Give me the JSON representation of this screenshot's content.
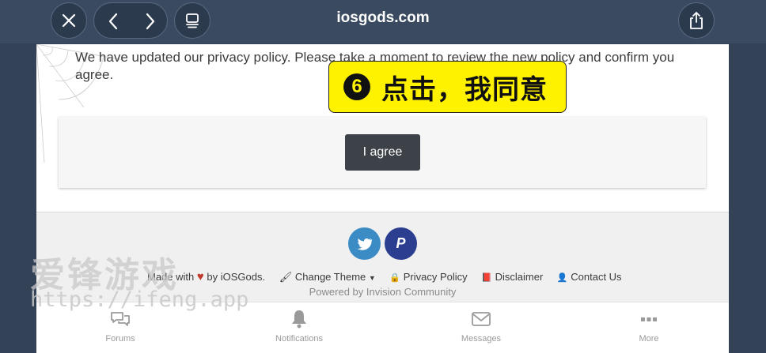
{
  "toolbar": {
    "url": "iosgods.com"
  },
  "policy": {
    "text": "We have updated our privacy policy. Please take a moment to review the new policy and confirm you agree.",
    "agree_label": "I agree"
  },
  "callout": {
    "number": "6",
    "text": "点击，我同意",
    "fill": "#fff200"
  },
  "footer": {
    "social": [
      {
        "icon": "twitter-icon",
        "color": "#3b8cc4"
      },
      {
        "icon": "paypal-icon",
        "color": "#2b3e8f",
        "glyph": "P"
      }
    ],
    "made_with_prefix": "Made with",
    "made_with_suffix": "by iOSGods.",
    "heart_color": "#c0392b",
    "change_theme": "Change Theme",
    "privacy_policy": "Privacy Policy",
    "disclaimer": "Disclaimer",
    "contact_us": "Contact Us",
    "powered_by": "Powered by Invision Community"
  },
  "tabbar": {
    "tabs": [
      {
        "label": "Forums",
        "icon": "chat-bubbles-icon"
      },
      {
        "label": "Notifications",
        "icon": "bell-icon"
      },
      {
        "label": "Messages",
        "icon": "envelope-icon"
      },
      {
        "label": "More",
        "icon": "dots-icon"
      }
    ]
  },
  "watermark": {
    "title": "爱锋游戏",
    "url": "https://ifeng.app"
  }
}
